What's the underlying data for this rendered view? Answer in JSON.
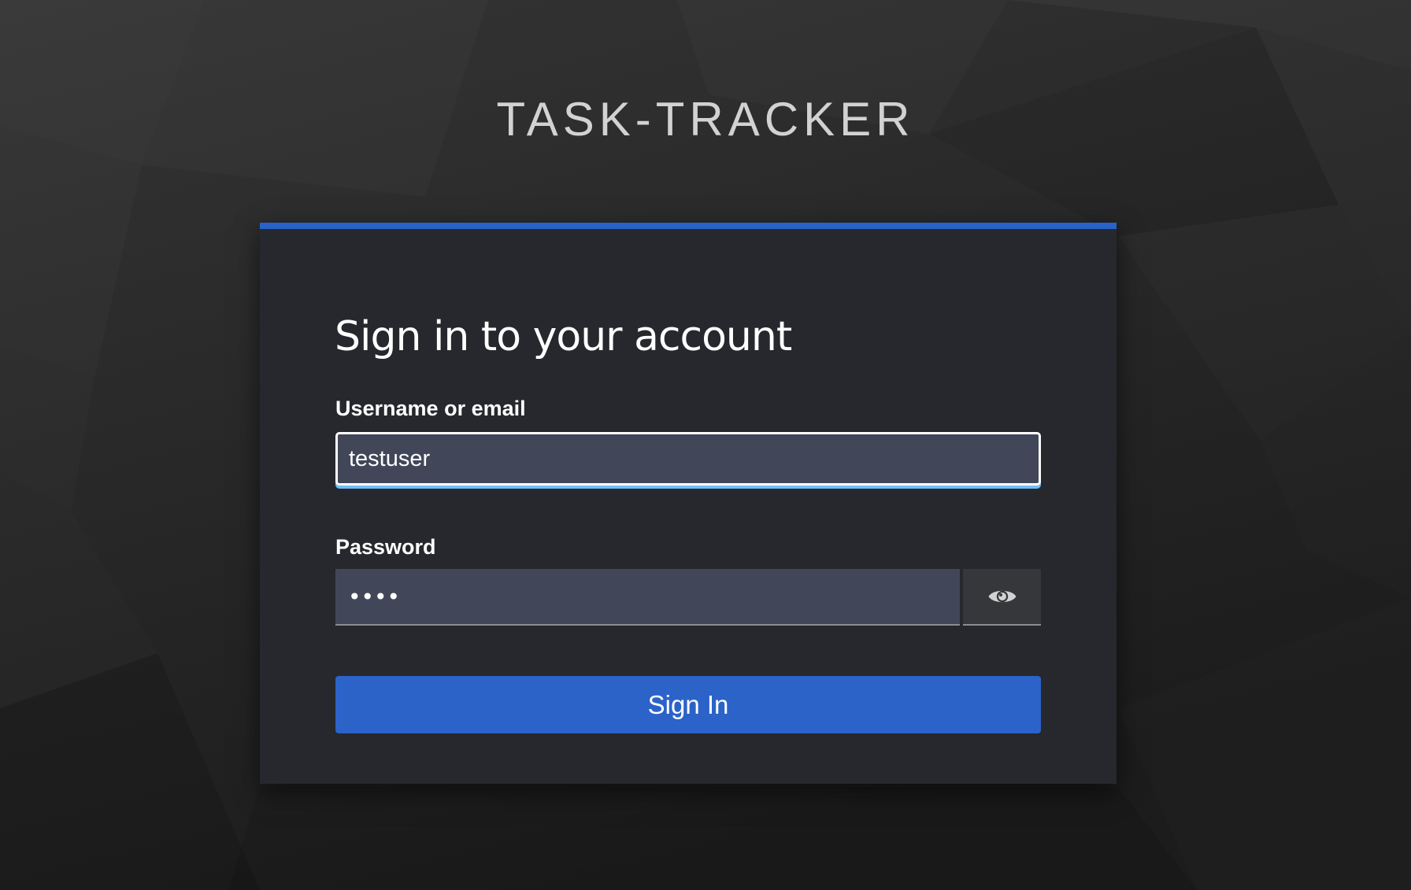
{
  "brand": {
    "title": "TASK-TRACKER"
  },
  "login": {
    "heading": "Sign in to your account",
    "username_label": "Username or email",
    "username_value": "testuser",
    "password_label": "Password",
    "password_value": "test",
    "submit_label": "Sign In"
  },
  "icons": {
    "password_toggle": "eye-icon"
  },
  "colors": {
    "accent": "#2863c9",
    "card_background": "#26282d",
    "input_background": "#414758",
    "focus_underline": "#73bcf7"
  }
}
